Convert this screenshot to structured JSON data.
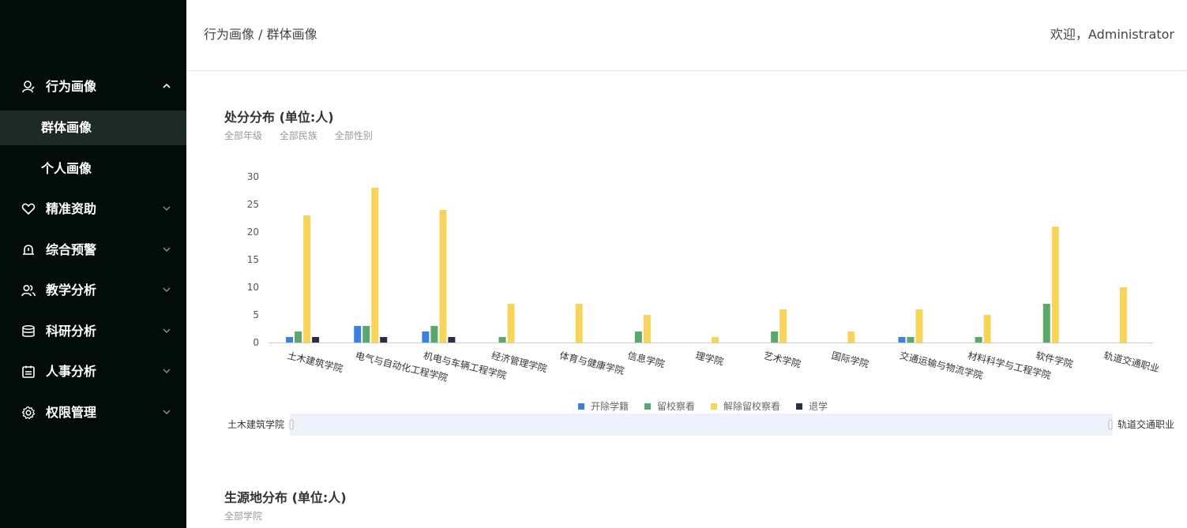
{
  "sidebar": {
    "items": [
      {
        "label": "行为画像",
        "icon": "user-behavior-icon",
        "expanded": true,
        "children": [
          {
            "label": "群体画像",
            "active": true
          },
          {
            "label": "个人画像",
            "active": false
          }
        ]
      },
      {
        "label": "精准资助",
        "icon": "heart-hand-icon",
        "expanded": false
      },
      {
        "label": "综合预警",
        "icon": "alarm-bell-icon",
        "expanded": false
      },
      {
        "label": "教学分析",
        "icon": "users-icon",
        "expanded": false
      },
      {
        "label": "科研分析",
        "icon": "database-icon",
        "expanded": false
      },
      {
        "label": "人事分析",
        "icon": "id-card-icon",
        "expanded": false
      },
      {
        "label": "权限管理",
        "icon": "gear-icon",
        "expanded": false
      }
    ]
  },
  "header": {
    "breadcrumb": "行为画像 / 群体画像",
    "welcome": "欢迎，Administrator"
  },
  "card1": {
    "title": "处分分布 (单位:人)",
    "filters": [
      "全部年级",
      "全部民族",
      "全部性别"
    ],
    "zoom_start_label": "土木建筑学院",
    "zoom_end_label": "轨道交通职业"
  },
  "card2": {
    "title": "生源地分布 (单位:人)",
    "filters": [
      "全部学院"
    ]
  },
  "chart_data": {
    "type": "bar",
    "title": "处分分布 (单位:人)",
    "categories": [
      "土木建筑学院",
      "电气与自动化工程学院",
      "机电与车辆工程学院",
      "经济管理学院",
      "体育与健康学院",
      "信息学院",
      "理学院",
      "艺术学院",
      "国际学院",
      "交通运输与物流学院",
      "材料科学与工程学院",
      "软件学院",
      "轨道交通职业"
    ],
    "series": [
      {
        "name": "开除学籍",
        "color": "#3b82e0",
        "values": [
          1,
          3,
          2,
          0,
          0,
          0,
          0,
          0,
          0,
          1,
          0,
          0,
          0
        ]
      },
      {
        "name": "留校察看",
        "color": "#5aa86b",
        "values": [
          2,
          3,
          3,
          1,
          0,
          2,
          0,
          2,
          0,
          1,
          1,
          7,
          0
        ]
      },
      {
        "name": "解除留校察看",
        "color": "#f7d55a",
        "values": [
          23,
          28,
          24,
          7,
          7,
          5,
          1,
          6,
          2,
          6,
          5,
          21,
          10
        ]
      },
      {
        "name": "退学",
        "color": "#2b2d48",
        "values": [
          1,
          1,
          1,
          0,
          0,
          0,
          0,
          0,
          0,
          0,
          0,
          0,
          0
        ]
      }
    ],
    "yticks": [
      0,
      5,
      10,
      15,
      20,
      25,
      30
    ],
    "ylim": [
      0,
      30
    ],
    "legend_position": "bottom",
    "grid": false
  }
}
